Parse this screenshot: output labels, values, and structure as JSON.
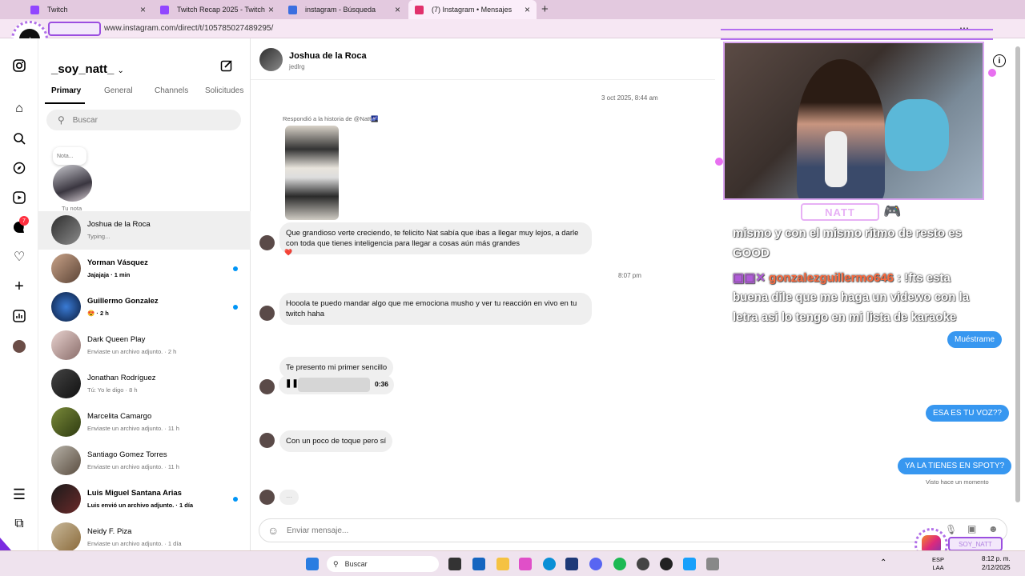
{
  "browser": {
    "tabs": [
      {
        "label": "Twitch",
        "color": "#9146ff"
      },
      {
        "label": "Twitch Recap 2025 - Twitch",
        "color": "#9146ff"
      },
      {
        "label": "instagram - Búsqueda",
        "color": "#3b6fe0"
      },
      {
        "label": "(7) Instagram • Mensajes",
        "color": "#e1306c"
      }
    ],
    "url": "www.instagram.com/direct/t/105785027489295/"
  },
  "inbox": {
    "username": "_soy_natt_",
    "tabs": [
      "Primary",
      "General",
      "Channels",
      "Solicitudes"
    ],
    "search_placeholder": "Buscar",
    "note_label": "Nota...",
    "note_caption": "Tu nota",
    "unread_badge": "7",
    "conversations": [
      {
        "name": "Joshua de la Roca",
        "sub": "Typing..."
      },
      {
        "name": "Yorman Vásquez",
        "sub": "Jajajaja · 1 min"
      },
      {
        "name": "Guillermo Gonzalez",
        "sub": "😍 · 2 h"
      },
      {
        "name": "Dark Queen Play",
        "sub": "Enviaste un archivo adjunto. · 2 h"
      },
      {
        "name": "Jonathan Rodríguez",
        "sub": "Tú: Yo le digo · 8 h"
      },
      {
        "name": "Marcelita Camargo",
        "sub": "Enviaste un archivo adjunto. · 11 h"
      },
      {
        "name": "Santiago Gomez Torres",
        "sub": "Enviaste un archivo adjunto. · 11 h"
      },
      {
        "name": "Luis Miguel Santana Arias",
        "sub": "Luis envió un archivo adjunto. · 1 día"
      },
      {
        "name": "Neidy F. Piza",
        "sub": "Enviaste un archivo adjunto. · 1 día"
      }
    ]
  },
  "chat": {
    "contact_name": "Joshua de la Roca",
    "contact_handle": "jedlrg",
    "date_1": "3 oct 2025, 8:44 am",
    "story_reply": "Respondió a la historia de @Natt🌌",
    "msg_1": "Que grandioso verte creciendo, te felicito Nat sabía que ibas a llegar muy lejos, a darle con toda que tienes inteligencia para llegar a cosas aún más grandes",
    "reaction": "❤️",
    "time_2": "8:07 pm",
    "msg_2": "Hooola te puedo mandar algo que me emociona musho y ver tu reacción en vivo en tu twitch haha",
    "msg_3": "Te presento mi primer sencillo",
    "audio_duration": "0:36",
    "msg_4": "Con un poco de toque pero sí",
    "typing": "···",
    "reply_1": "Muéstrame",
    "reply_2": "ESA ES TU VOZ??",
    "reply_3": "YA LA TIENES EN SPOTY?",
    "seen": "Visto hace un momento",
    "composer_placeholder": "Enviar mensaje..."
  },
  "overlay": {
    "streamer_label": "NATT",
    "chat_line_1": "mismo y con el mismo ritmo de resto es",
    "chat_line_2": "GOOD",
    "chat_user": "gonzalezguillermo646",
    "chat_line_3": ": !fts esta",
    "chat_line_4": "buena dile que me haga un videwo con la",
    "chat_line_5": "letra asi lo tengo en mi lista de karaoke",
    "bottom_badge": "SOY_NATT"
  },
  "taskbar": {
    "search_label": "Buscar",
    "lang": "ESP\nLAA",
    "time": "8:12 p. m.",
    "date": "2/12/2025"
  }
}
